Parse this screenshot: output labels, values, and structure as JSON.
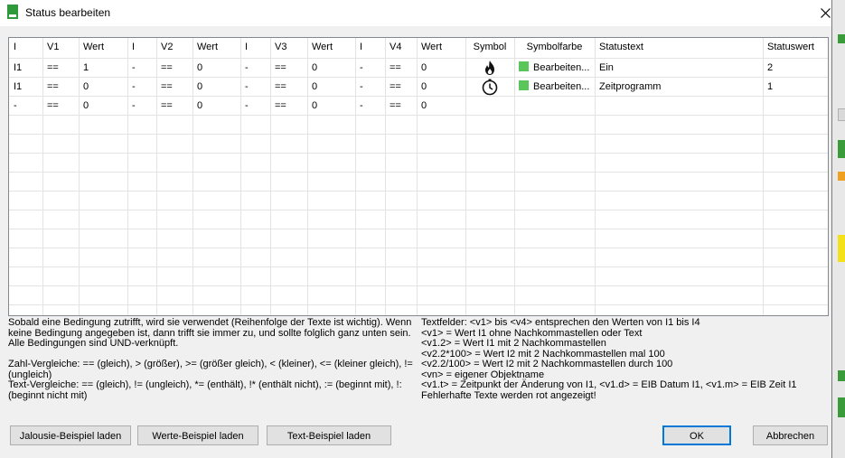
{
  "window": {
    "title": "Status bearbeiten",
    "app_icon": "status-app-icon",
    "close_icon": "close-icon"
  },
  "table": {
    "columns": [
      "I",
      "V1",
      "Wert",
      "I",
      "V2",
      "Wert",
      "I",
      "V3",
      "Wert",
      "I",
      "V4",
      "Wert",
      "Symbol",
      "Symbolfarbe",
      "Statustext",
      "Statuswert"
    ],
    "rows": [
      {
        "cells": [
          "I1",
          "==",
          "1",
          "-",
          "==",
          "0",
          "-",
          "==",
          "0",
          "-",
          "==",
          "0"
        ],
        "symbol": "flame-icon",
        "color_label": "Bearbeiten...",
        "color": "#58c65a",
        "statustext": "Ein",
        "statuswert": "2"
      },
      {
        "cells": [
          "I1",
          "==",
          "0",
          "-",
          "==",
          "0",
          "-",
          "==",
          "0",
          "-",
          "==",
          "0"
        ],
        "symbol": "clock-icon",
        "color_label": "Bearbeiten...",
        "color": "#58c65a",
        "statustext": "Zeitprogramm",
        "statuswert": "1"
      },
      {
        "cells": [
          "-",
          "==",
          "0",
          "-",
          "==",
          "0",
          "-",
          "==",
          "0",
          "-",
          "==",
          "0"
        ],
        "symbol": "",
        "color_label": "",
        "color": "",
        "statustext": "",
        "statuswert": ""
      }
    ]
  },
  "help": {
    "left": "Sobald eine Bedingung zutrifft, wird sie verwendet (Reihenfolge der Texte ist wichtig). Wenn keine Bedingung angegeben ist, dann trifft sie immer zu, und sollte folglich ganz unten sein. Alle Bedingungen sind UND-verknüpft.\n\nZahl-Vergleiche: == (gleich), > (größer), >= (größer gleich), < (kleiner), <= (kleiner gleich), != (ungleich)\nText-Vergleiche: == (gleich), != (ungleich), *= (enthält), !* (enthält nicht), := (beginnt mit), !: (beginnt nicht mit)",
    "right": "Textfelder: <v1> bis <v4> entsprechen den Werten von I1 bis I4\n<v1> = Wert I1 ohne Nachkommastellen oder Text\n<v1.2> = Wert I1 mit 2 Nachkommastellen\n<v2.2*100> = Wert I2 mit 2 Nachkommastellen mal 100\n<v2.2/100> = Wert I2 mit 2 Nachkommastellen durch 100\n<vn> = eigener Objektname\n<v1.t> = Zeitpunkt der Änderung von I1, <v1.d> = EIB Datum I1, <v1.m> = EIB Zeit I1\nFehlerhafte Texte werden rot angezeigt!"
  },
  "buttons": {
    "jalousie": "Jalousie-Beispiel laden",
    "werte": "Werte-Beispiel laden",
    "text": "Text-Beispiel laden",
    "ok": "OK",
    "cancel": "Abbrechen"
  }
}
